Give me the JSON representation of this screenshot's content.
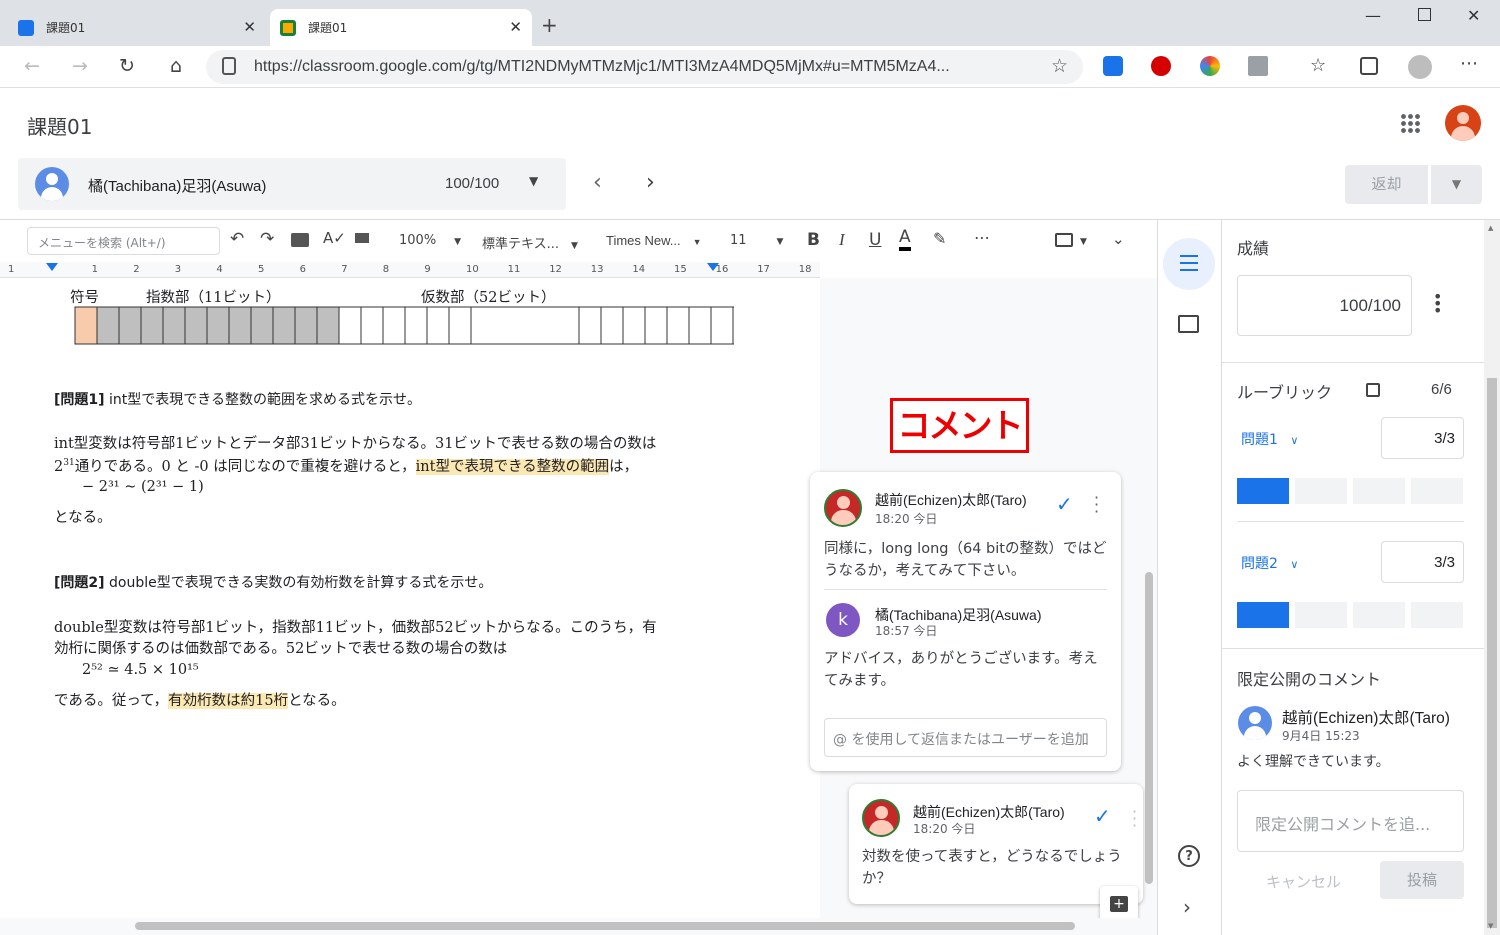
{
  "browser": {
    "tabs": [
      {
        "title": "課題01"
      },
      {
        "title": "課題01"
      }
    ],
    "url": "https://classroom.google.com/g/tg/MTI2NDMyMTMzMjc1/MTI3MzA4MDQ5MjMx#u=MTM5MzA4..."
  },
  "header": {
    "title": "課題01"
  },
  "student": {
    "name": "橘(Tachibana)足羽(Asuwa)",
    "score": "100/100"
  },
  "return_button": "返却",
  "toolbar": {
    "menu_search_placeholder": "メニューを検索 (Alt+/)",
    "zoom": "100%",
    "style": "標準テキス...",
    "font": "Times New...",
    "size": "11",
    "bold": "B",
    "italic": "I",
    "underline": "U",
    "color": "A"
  },
  "ruler": {
    "marks": [
      "1",
      "1",
      "2",
      "3",
      "4",
      "5",
      "6",
      "7",
      "8",
      "9",
      "10",
      "11",
      "12",
      "13",
      "14",
      "15",
      "16",
      "17",
      "18"
    ]
  },
  "doc": {
    "fig_sign": "符号",
    "fig_exp": "指数部（11ビット）",
    "fig_mant": "仮数部（52ビット）",
    "q1_label": "[問題1]",
    "q1_text": " int型で表現できる整数の範囲を求める式を示せ。",
    "a1_line1": "int型変数は符号部1ビットとデータ部31ビットからなる。31ビットで表せる数の場合の数は",
    "a1_line2a": "2",
    "a1_line2sup": "31",
    "a1_line2b": "通りである。0 と -0 は同じなので重複を避けると，",
    "a1_line2hl": "int型で表現できる整数の範囲",
    "a1_line2c": "は，",
    "a1_formula": "− 2³¹ ∼ (2³¹ − 1)",
    "a1_end": "となる。",
    "q2_label": "[問題2]",
    "q2_text": " double型で表現できる実数の有効桁数を計算する式を示せ。",
    "a2_line1": "double型変数は符号部1ビット，指数部11ビット，価数部52ビットからなる。このうち，有",
    "a2_line2": "効桁に関係するのは価数部である。52ビットで表せる数の場合の数は",
    "a2_formula": "2⁵² ≃ 4.5 × 10¹⁵",
    "a2_end_a": "である。従って，",
    "a2_end_hl": "有効桁数は約15桁",
    "a2_end_b": "となる。"
  },
  "overlay_label": "コメント",
  "comments": {
    "thread1": [
      {
        "author": "越前(Echizen)太郎(Taro)",
        "time": "18:20 今日",
        "text": "同様に，long long（64 bitの整数）ではどうなるか，考えてみて下さい。"
      },
      {
        "author": "橘(Tachibana)足羽(Asuwa)",
        "initial": "k",
        "time": "18:57 今日",
        "text": "アドバイス，ありがとうございます。考えてみます。"
      }
    ],
    "reply_placeholder": "@ を使用して返信またはユーザーを追加",
    "thread2": {
      "author": "越前(Echizen)太郎(Taro)",
      "time": "18:20 今日",
      "text": "対数を使って表すと，どうなるでしょうか？"
    }
  },
  "grade": {
    "title": "成績",
    "value": "100/100",
    "rubric_title": "ルーブリック",
    "rubric_total": "6/6",
    "rubric_items": [
      {
        "name": "問題1",
        "score": "3/3",
        "level": 1
      },
      {
        "name": "問題2",
        "score": "3/3",
        "level": 1
      }
    ],
    "private_title": "限定公開のコメント",
    "private_comment": {
      "author": "越前(Echizen)太郎(Taro)",
      "time": "9月4日 15:23",
      "text": "よく理解できています。"
    },
    "private_placeholder": "限定公開コメントを追...",
    "cancel": "キャンセル",
    "post": "投稿"
  }
}
